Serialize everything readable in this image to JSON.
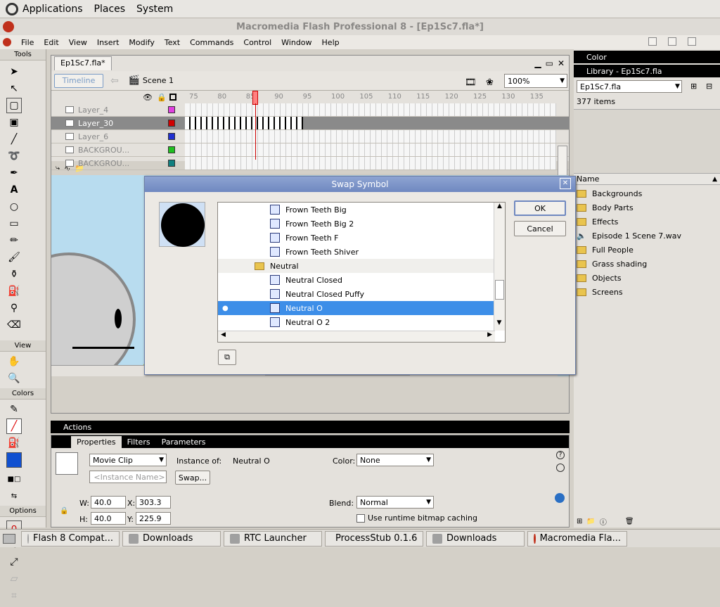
{
  "gnome": {
    "menu": [
      "Applications",
      "Places",
      "System"
    ]
  },
  "window": {
    "title": "Macromedia Flash Professional 8 - [Ep1Sc7.fla*]"
  },
  "menubar": [
    "File",
    "Edit",
    "View",
    "Insert",
    "Modify",
    "Text",
    "Commands",
    "Control",
    "Window",
    "Help"
  ],
  "toolbox": {
    "tools_label": "Tools",
    "view_label": "View",
    "colors_label": "Colors",
    "options_label": "Options"
  },
  "document": {
    "tab": "Ep1Sc7.fla*",
    "timeline_btn": "Timeline",
    "scene": "Scene 1",
    "zoom": "100%",
    "frame_numbers": [
      "75",
      "80",
      "85",
      "90",
      "95",
      "100",
      "105",
      "110",
      "115",
      "120",
      "125",
      "130",
      "135"
    ],
    "layers": [
      {
        "name": "Layer_4",
        "color": "#e040e0"
      },
      {
        "name": "Layer_30",
        "color": "#d00000"
      },
      {
        "name": "Layer_6",
        "color": "#2030d0"
      },
      {
        "name": "BACKGROU...",
        "color": "#20c020"
      },
      {
        "name": "BACKGROU...",
        "color": "#108080"
      }
    ]
  },
  "actions_label": "Actions",
  "properties": {
    "tabs": [
      "Properties",
      "Filters",
      "Parameters"
    ],
    "symbol_type": "Movie Clip",
    "instance_placeholder": "<Instance Name>",
    "instance_of_label": "Instance of:",
    "instance_of_value": "Neutral O",
    "swap_btn": "Swap...",
    "color_label": "Color:",
    "color_value": "None",
    "w_label": "W:",
    "w_value": "40.0",
    "x_label": "X:",
    "x_value": "303.3",
    "h_label": "H:",
    "h_value": "40.0",
    "y_label": "Y:",
    "y_value": "225.9",
    "blend_label": "Blend:",
    "blend_value": "Normal",
    "bitmap_caching": "Use runtime bitmap caching"
  },
  "right_panel": {
    "color_title": "Color",
    "library_title": "Library - Ep1Sc7.fla",
    "library_select": "Ep1Sc7.fla",
    "item_count": "377 items",
    "name_header": "Name",
    "items": [
      {
        "label": "Backgrounds",
        "type": "folder"
      },
      {
        "label": "Body Parts",
        "type": "folder"
      },
      {
        "label": "Effects",
        "type": "folder"
      },
      {
        "label": "Episode 1 Scene 7.wav",
        "type": "sound"
      },
      {
        "label": "Full People",
        "type": "folder"
      },
      {
        "label": "Grass shading",
        "type": "folder"
      },
      {
        "label": "Objects",
        "type": "folder"
      },
      {
        "label": "Screens",
        "type": "folder"
      }
    ]
  },
  "dialog": {
    "title": "Swap Symbol",
    "ok": "OK",
    "cancel": "Cancel",
    "items": [
      {
        "label": "Frown Teeth Big",
        "type": "symbol"
      },
      {
        "label": "Frown Teeth Big 2",
        "type": "symbol"
      },
      {
        "label": "Frown Teeth F",
        "type": "symbol"
      },
      {
        "label": "Frown Teeth Shiver",
        "type": "symbol"
      },
      {
        "label": "Neutral",
        "type": "folder"
      },
      {
        "label": "Neutral Closed",
        "type": "symbol"
      },
      {
        "label": "Neutral Closed Puffy",
        "type": "symbol"
      },
      {
        "label": "Neutral O",
        "type": "symbol",
        "selected": true
      },
      {
        "label": "Neutral O 2",
        "type": "symbol"
      }
    ]
  },
  "taskbar": [
    "Flash 8 Compat...",
    "Downloads",
    "RTC Launcher",
    "ProcessStub 0.1.6",
    "Downloads",
    "Macromedia Fla..."
  ]
}
